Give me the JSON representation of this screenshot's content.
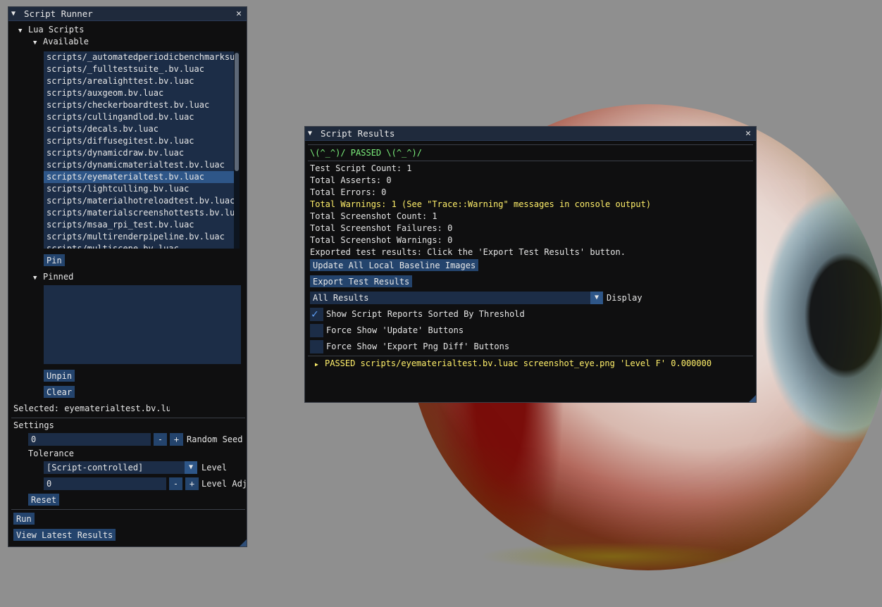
{
  "runner": {
    "title": "Script Runner",
    "lua_scripts_label": "Lua Scripts",
    "available_label": "Available",
    "scripts": [
      "scripts/_automatedperiodicbenchmarksu",
      "scripts/_fulltestsuite_.bv.luac",
      "scripts/arealighttest.bv.luac",
      "scripts/auxgeom.bv.luac",
      "scripts/checkerboardtest.bv.luac",
      "scripts/cullingandlod.bv.luac",
      "scripts/decals.bv.luac",
      "scripts/diffusegitest.bv.luac",
      "scripts/dynamicdraw.bv.luac",
      "scripts/dynamicmaterialtest.bv.luac",
      "scripts/eyematerialtest.bv.luac",
      "scripts/lightculling.bv.luac",
      "scripts/materialhotreloadtest.bv.luac",
      "scripts/materialscreenshottests.bv.lua",
      "scripts/msaa_rpi_test.bv.luac",
      "scripts/multirenderpipeline.bv.luac",
      "scripts/multiscene.bv.luac"
    ],
    "selected_index": 10,
    "pin_button": "Pin",
    "pinned_label": "Pinned",
    "unpin_button": "Unpin",
    "clear_button": "Clear",
    "selected_text": "Selected: eyematerialtest.bv.lua",
    "settings_label": "Settings",
    "random_seed_value": "0",
    "minus": "-",
    "plus": "+",
    "random_seed_label": "Random Seed",
    "tolerance_label": "Tolerance",
    "level_value": "[Script-controlled]",
    "level_label": "Level",
    "level_adj_value": "0",
    "level_adj_label": "Level Adj",
    "reset_button": "Reset",
    "run_button": "Run",
    "view_results_button": "View Latest Results"
  },
  "results": {
    "title": "Script Results",
    "status": "\\(^_^)/  PASSED  \\(^_^)/",
    "test_script_count": "Test Script Count: 1",
    "total_asserts": "Total Asserts:  0",
    "total_errors": "Total Errors:   0",
    "total_warnings": "Total Warnings: 1 (See \"Trace::Warning\" messages in console output)",
    "screenshot_count": "Total Screenshot Count: 1",
    "screenshot_failures": "Total Screenshot Failures: 0",
    "screenshot_warnings": "Total Screenshot Warnings: 0",
    "exported_text": "Exported test results: Click the 'Export Test Results' button.",
    "update_baseline_button": "Update All Local Baseline Images",
    "export_button": "Export Test Results",
    "display_value": "All Results",
    "display_label": "Display",
    "checkbox_sorted": "Show Script Reports Sorted By Threshold",
    "checkbox_sorted_checked": true,
    "checkbox_update": "Force Show 'Update' Buttons",
    "checkbox_update_checked": false,
    "checkbox_pngdiff": "Force Show 'Export Png Diff' Buttons",
    "checkbox_pngdiff_checked": false,
    "report_line": "PASSED scripts/eyematerialtest.bv.luac screenshot_eye.png 'Level F' 0.000000"
  },
  "icons": {
    "collapse": "triangle-down-icon",
    "close": "close-icon",
    "expand": "triangle-right-icon",
    "check": "checkmark-icon"
  },
  "colors": {
    "accent": "#24446d",
    "selection": "#2e5688",
    "passed": "#7cf07c",
    "warning": "#ffef6a"
  }
}
